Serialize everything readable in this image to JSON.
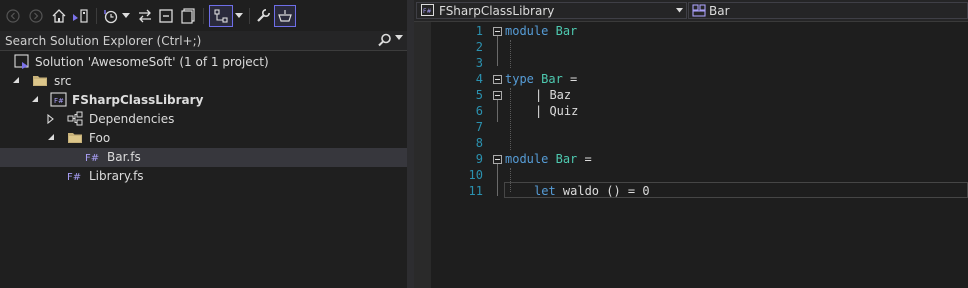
{
  "solution_explorer": {
    "toolbar": {
      "icons": [
        "back-icon",
        "forward-icon",
        "home-icon",
        "switch-views-icon",
        "history-icon",
        "sync-icon",
        "collapse-all-icon",
        "show-all-files-icon",
        "preview-selected-icon",
        "properties-icon",
        "filter-icon"
      ]
    },
    "search": {
      "placeholder": "Search Solution Explorer (Ctrl+;)"
    },
    "tree": [
      {
        "label": "Solution 'AwesomeSoft' (1 of 1 project)",
        "icon": "solution-icon"
      },
      {
        "label": "src",
        "icon": "folder-icon",
        "expanded": true
      },
      {
        "label": "FSharpClassLibrary",
        "icon": "fsharp-project-icon",
        "expanded": true,
        "bold": true
      },
      {
        "label": "Dependencies",
        "icon": "dependencies-icon",
        "expanded": false
      },
      {
        "label": "Foo",
        "icon": "folder-icon",
        "expanded": true
      },
      {
        "label": "Bar.fs",
        "icon": "fsharp-file-icon",
        "selected": true
      },
      {
        "label": "Library.fs",
        "icon": "fsharp-file-icon"
      }
    ]
  },
  "editor": {
    "nav_left": "FSharpClassLibrary",
    "nav_right": "Bar",
    "line_numbers": [
      "1",
      "2",
      "3",
      "4",
      "5",
      "6",
      "7",
      "8",
      "9",
      "10",
      "11"
    ],
    "lines": {
      "l1_kw": "module",
      "l1_name": "Bar",
      "l4_kw": "type",
      "l4_name": "Bar",
      "l4_rest": " =",
      "l5": "| Baz",
      "l6": "| Quiz",
      "l9_kw": "module",
      "l9_name": "Bar",
      "l9_rest": " =",
      "l11_kw": "let",
      "l11_rest": " waldo () = 0"
    }
  },
  "colors": {
    "keyword": "#569cd6",
    "type_name": "#4ec9b0",
    "line_number": "#2b91af",
    "selected_row": "#37373d"
  }
}
